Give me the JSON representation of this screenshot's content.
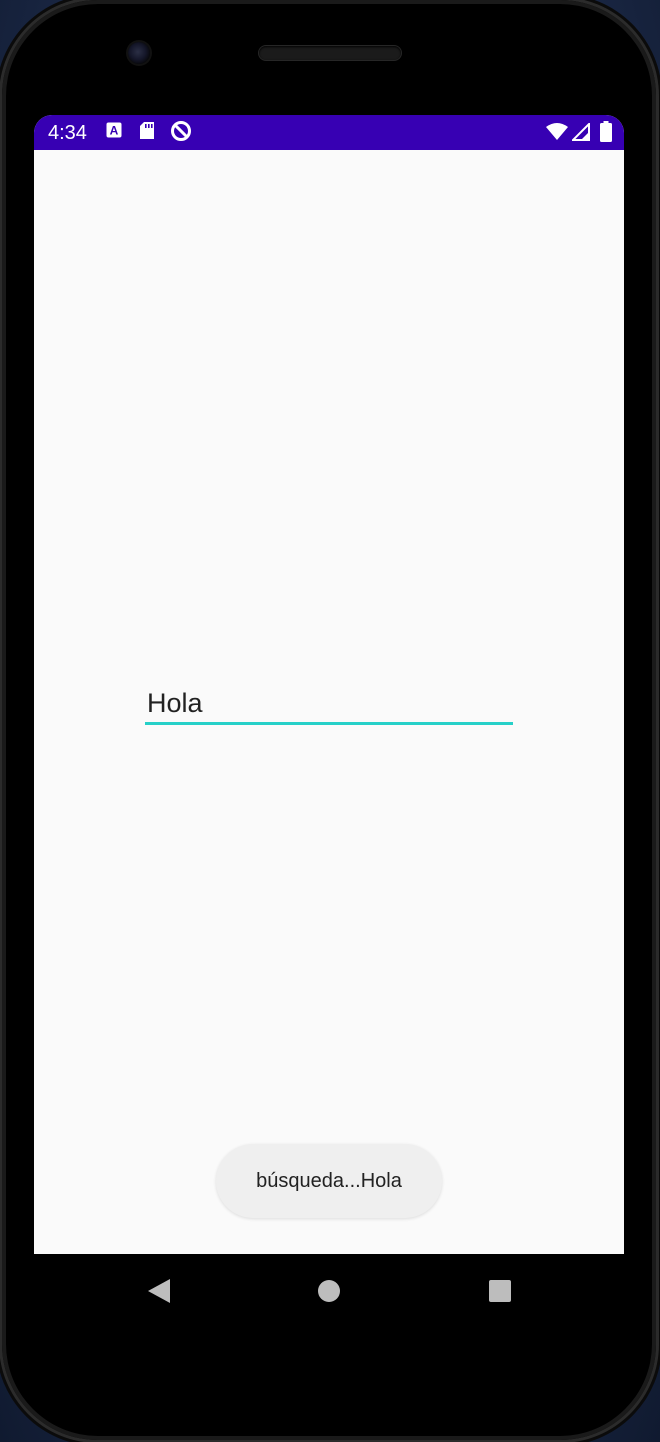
{
  "status_bar": {
    "time": "4:34",
    "background_color": "#3700b3",
    "left_icons": [
      "font-a-icon",
      "sd-card-icon",
      "do-not-disturb-icon"
    ],
    "right_icons": [
      "wifi-icon",
      "cell-signal-icon",
      "battery-icon"
    ]
  },
  "main": {
    "input_value": "Hola",
    "accent_color": "#26d0c8"
  },
  "toast": {
    "message": "búsqueda...Hola"
  },
  "nav_bar": {
    "buttons": [
      "back-icon",
      "home-icon",
      "recents-icon"
    ]
  }
}
